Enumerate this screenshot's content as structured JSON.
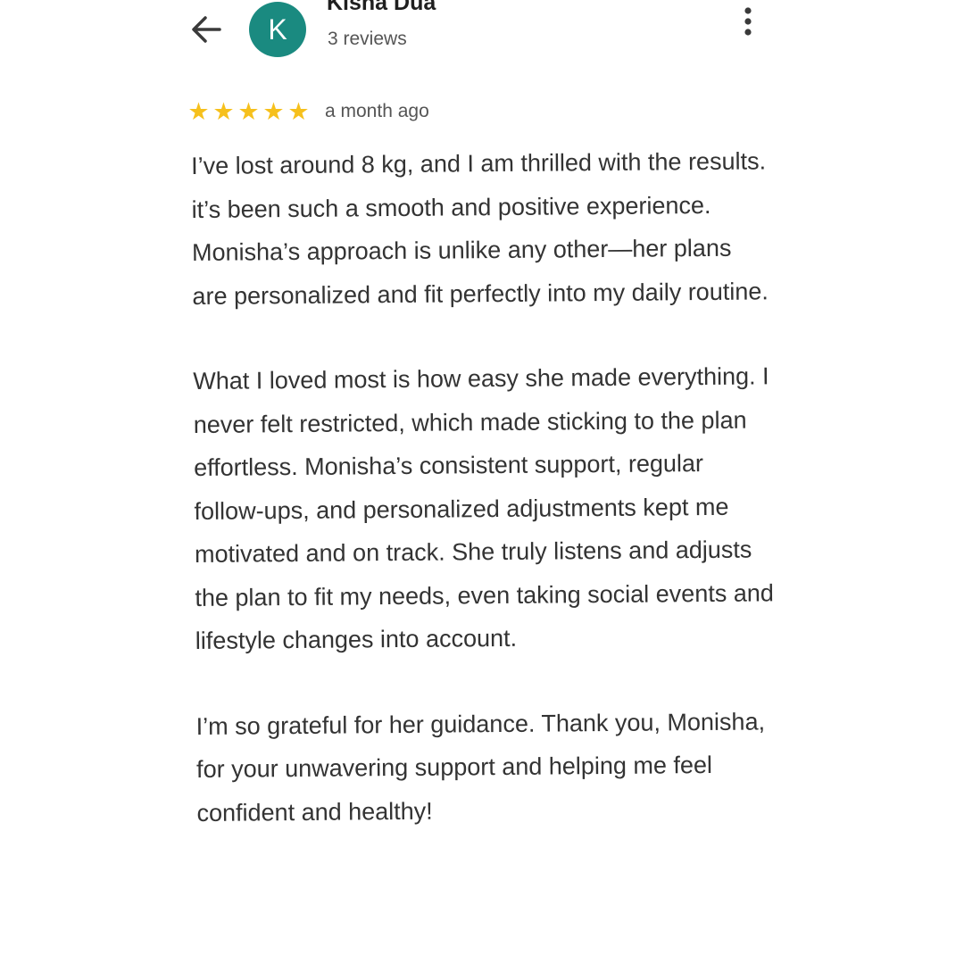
{
  "header": {
    "avatar_initial": "K",
    "reviewer_name": "Kisha Dua",
    "review_count": "3 reviews",
    "back_icon": "arrow-left-icon",
    "more_icon": "more-vertical-icon",
    "avatar_color": "#1a8a80"
  },
  "review": {
    "rating": 5,
    "rating_max": 5,
    "star_color": "#f6c01c",
    "date": "a month ago",
    "paragraphs": [
      "I’ve lost around 8 kg, and I am thrilled with the results. it’s been such a smooth and positive experience. Monisha’s approach is unlike any other—her plans are personalized and fit perfectly into my daily routine.",
      "What I loved most is how easy she made everything. I never felt restricted, which made sticking to the plan effortless. Monisha’s consistent support, regular follow-ups, and personalized adjustments kept me motivated and on track. She truly listens and adjusts the plan to fit my needs, even taking social events and lifestyle changes into account.",
      "I’m so grateful for her guidance. Thank you, Monisha, for your unwavering support and helping me feel confident and healthy!"
    ]
  }
}
